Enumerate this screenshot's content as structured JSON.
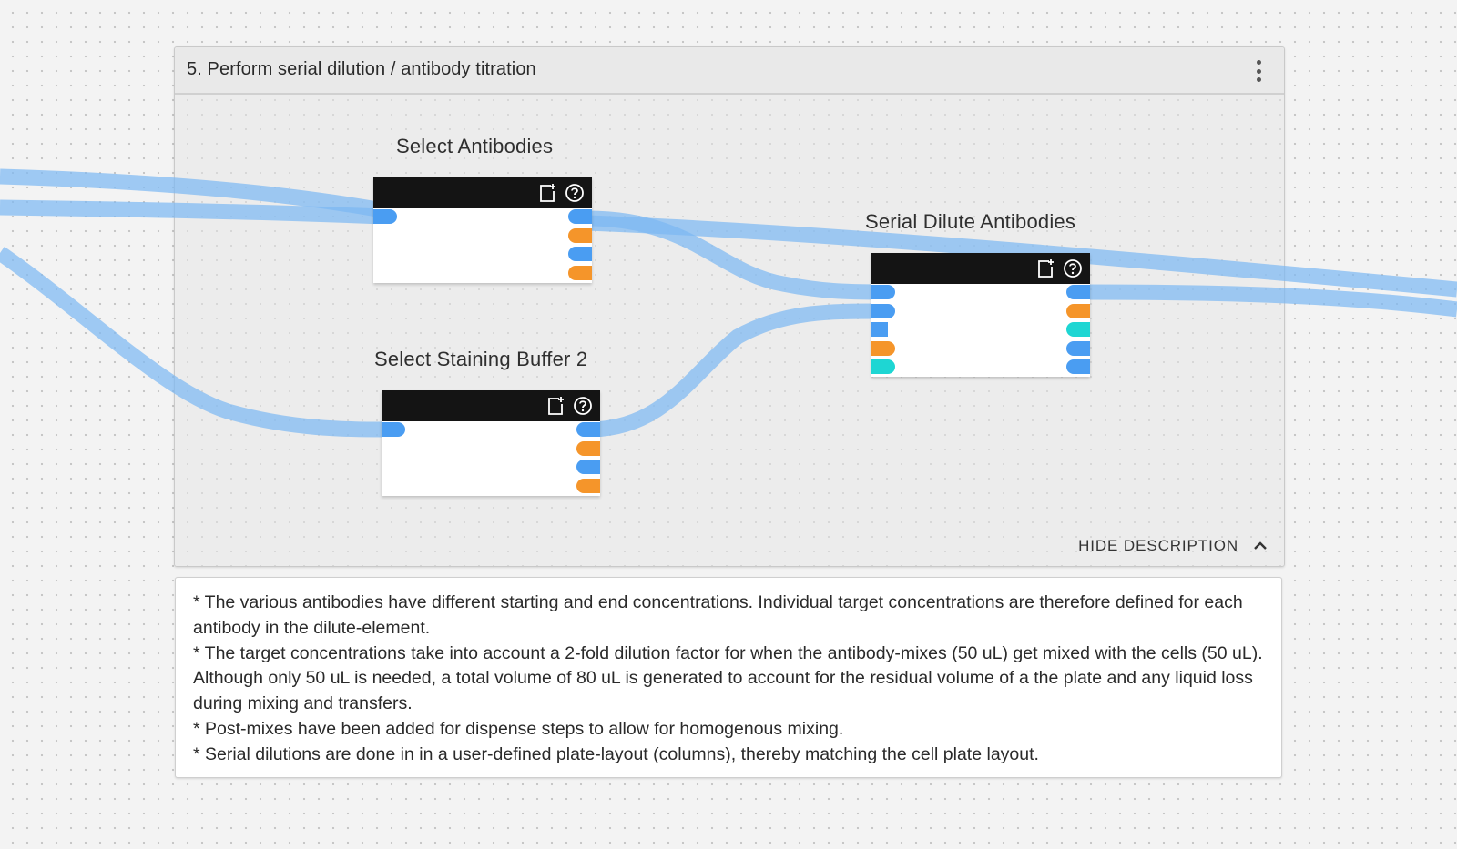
{
  "section": {
    "title": "5. Perform serial dilution / antibody titration",
    "menu_icon": "more-vert-icon",
    "hide_description_label": "HIDE DESCRIPTION",
    "collapse_icon": "chevron-up-icon"
  },
  "nodes": [
    {
      "id": "select-antibodies",
      "label": "Select Antibodies",
      "icons": [
        "add-note-icon",
        "help-icon"
      ],
      "inputs": [
        "blue"
      ],
      "outputs": [
        "blue",
        "orange",
        "blue",
        "orange"
      ]
    },
    {
      "id": "select-staining-buffer-2",
      "label": "Select Staining Buffer 2",
      "icons": [
        "add-note-icon",
        "help-icon"
      ],
      "inputs": [
        "blue"
      ],
      "outputs": [
        "blue",
        "orange",
        "blue",
        "orange"
      ]
    },
    {
      "id": "serial-dilute-antibodies",
      "label": "Serial Dilute Antibodies",
      "icons": [
        "add-note-icon",
        "help-icon"
      ],
      "inputs": [
        "blue",
        "blue",
        "blue",
        "orange",
        "cyan"
      ],
      "outputs": [
        "blue",
        "orange",
        "cyan",
        "blue",
        "blue"
      ]
    }
  ],
  "connections": [
    {
      "from": "external-left",
      "to": "select-antibodies.input.0"
    },
    {
      "from": "external-left",
      "to": "select-antibodies.input.0"
    },
    {
      "from": "external-left",
      "to": "select-staining-buffer-2.input.0"
    },
    {
      "from": "select-antibodies.output.0",
      "to": "serial-dilute-antibodies.input.0"
    },
    {
      "from": "select-staining-buffer-2.output.0",
      "to": "serial-dilute-antibodies.input.1"
    },
    {
      "from": "select-antibodies.output.0",
      "to": "external-right"
    },
    {
      "from": "serial-dilute-antibodies.output.0",
      "to": "external-right"
    }
  ],
  "colors": {
    "port_blue": "#4a9df2",
    "port_orange": "#f5952a",
    "port_cyan": "#1ed6d3",
    "wire": "#7db8f2",
    "node_header": "#141414"
  },
  "description": {
    "lines": [
      "* The various antibodies have different starting and end concentrations. Individual target concentrations are therefore defined for each antibody in the dilute-element.",
      "* The target concentrations take into account a 2-fold dilution factor for when the antibody-mixes (50 uL) get mixed with the cells (50 uL). Although only 50 uL is needed, a total volume of 80 uL is generated to account for the residual volume of a the plate and any liquid loss during mixing and transfers.",
      "* Post-mixes have been added for dispense steps to allow for homogenous mixing.",
      "* Serial dilutions are done in in a user-defined plate-layout (columns), thereby matching the cell plate layout."
    ]
  }
}
